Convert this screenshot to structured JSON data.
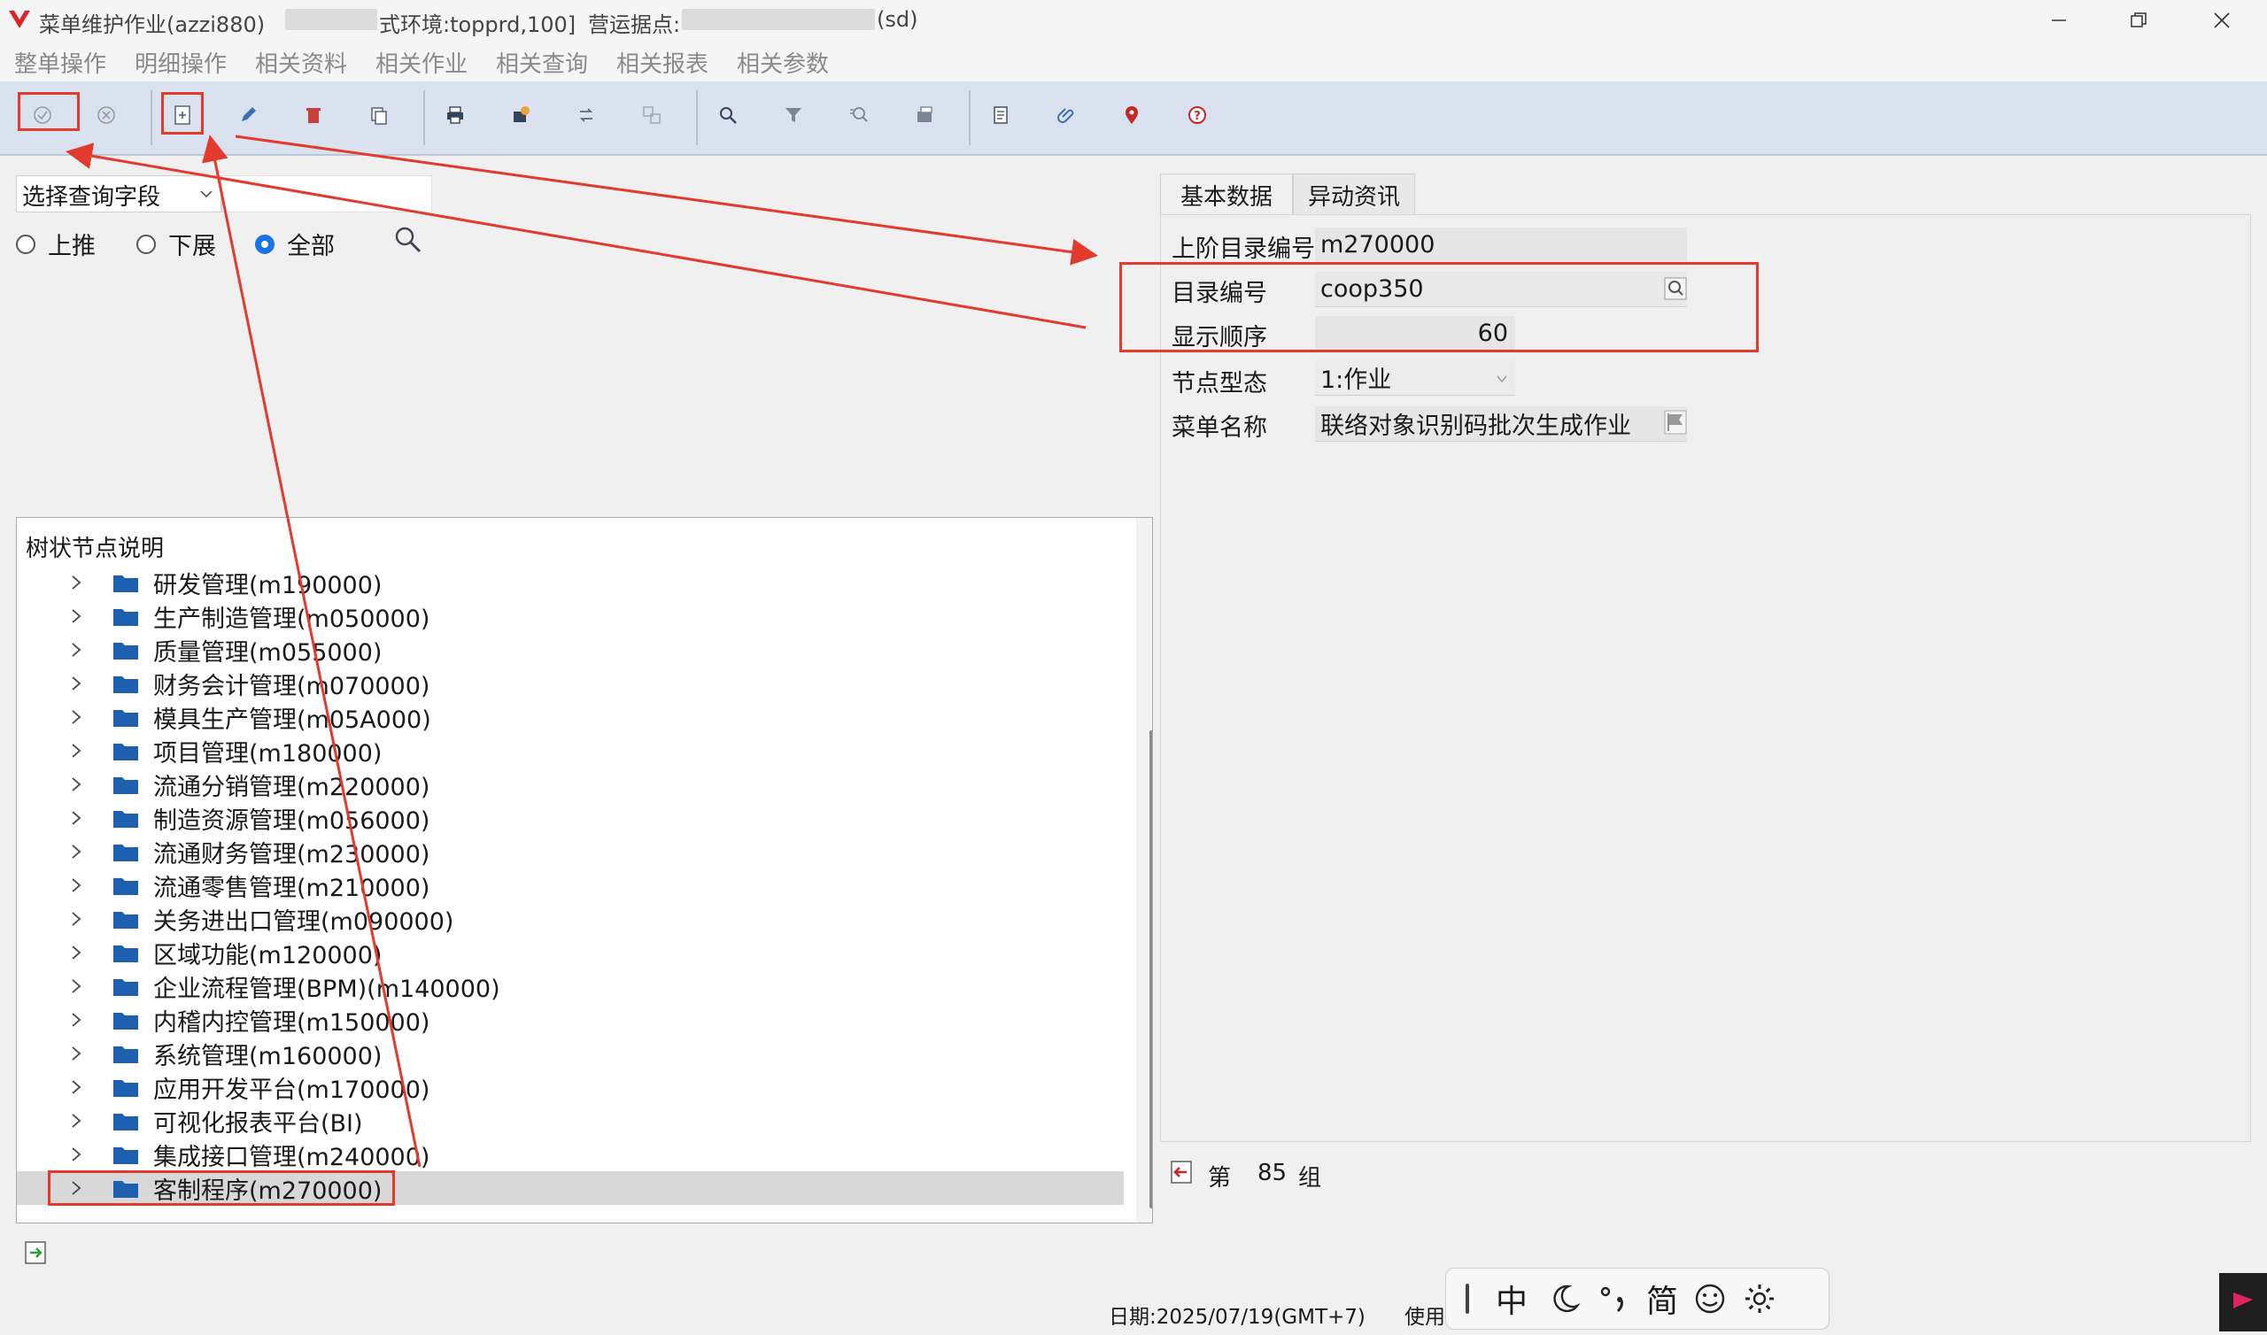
{
  "window": {
    "title": "菜单维护作业(azzi880)",
    "env_text": "式环境:topprd,100]",
    "site_label": "营运据点:",
    "site_suffix": "(sd)"
  },
  "menu": [
    "整单操作",
    "明细操作",
    "相关资料",
    "相关作业",
    "相关查询",
    "相关报表",
    "相关参数"
  ],
  "toolbar": {
    "icons": [
      "confirm-icon",
      "cancel-icon",
      "add-icon",
      "edit-icon",
      "delete-icon",
      "copy-icon",
      "print-icon",
      "export-icon",
      "transfer-icon",
      "batch-icon",
      "search-icon",
      "filter-icon",
      "query-icon",
      "output-icon",
      "note-icon",
      "attach-icon",
      "pin-icon",
      "help-icon"
    ]
  },
  "query": {
    "field_select": "选择查询字段",
    "radio_up": "上推",
    "radio_down": "下展",
    "radio_all": "全部"
  },
  "tree": {
    "header": "树状节点说明",
    "nodes": [
      "研发管理(m190000)",
      "生产制造管理(m050000)",
      "质量管理(m055000)",
      "财务会计管理(m070000)",
      "模具生产管理(m05A000)",
      "项目管理(m180000)",
      "流通分销管理(m220000)",
      "制造资源管理(m056000)",
      "流通财务管理(m230000)",
      "流通零售管理(m210000)",
      "关务进出口管理(m090000)",
      "区域功能(m120000)",
      "企业流程管理(BPM)(m140000)",
      "内稽内控管理(m150000)",
      "系统管理(m160000)",
      "应用开发平台(m170000)",
      "可视化报表平台(BI)",
      "集成接口管理(m240000)",
      "客制程序(m270000)"
    ]
  },
  "tabs": [
    "基本数据",
    "异动资讯"
  ],
  "form": {
    "parent_label": "上阶目录编号",
    "parent_value": "m270000",
    "dir_label": "目录编号",
    "dir_value": "coop350",
    "order_label": "显示顺序",
    "order_value": "60",
    "type_label": "节点型态",
    "type_value": "1:作业",
    "name_label": "菜单名称",
    "name_value": "联络对象识别码批次生成作业"
  },
  "record": {
    "prefix": "第",
    "count": "85",
    "suffix": "组"
  },
  "status": {
    "date": "日期:2025/07/19(GMT+7)",
    "user": "使用"
  },
  "ime": [
    "中",
    "简"
  ],
  "colors": {
    "accent": "#e23b2e",
    "toolbar": "#d9e2ee",
    "folder": "#1f5fb0",
    "radio": "#1a73e8"
  }
}
